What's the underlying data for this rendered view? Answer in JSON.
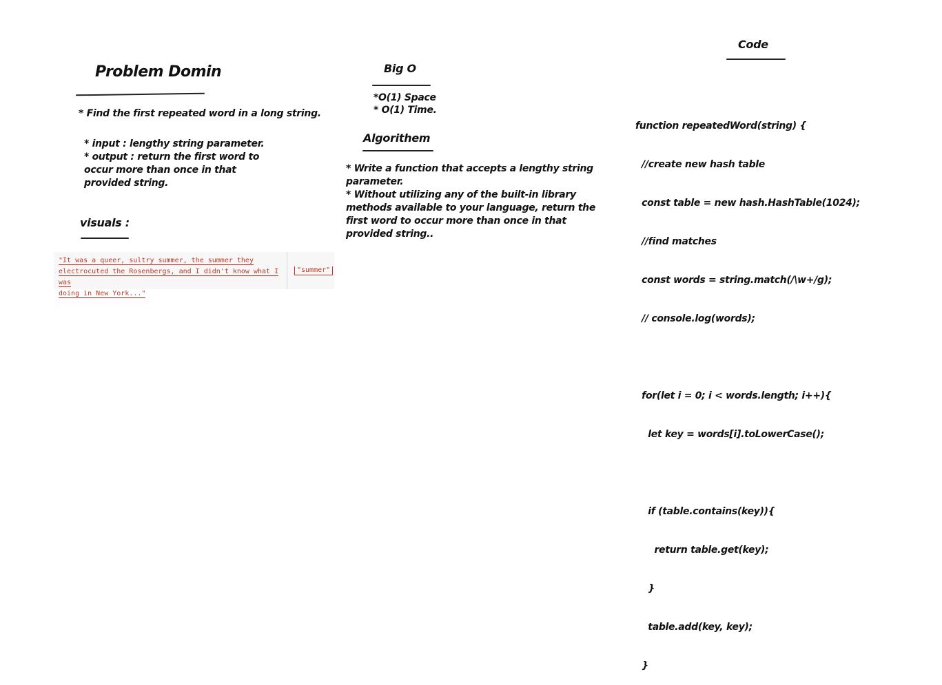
{
  "problem": {
    "heading": "Problem Domin",
    "statement": "* Find the first repeated word in a long string.",
    "input": "* input :  lengthy string parameter.",
    "output_lines": [
      "* output :  return the first word to",
      "occur more than once in that",
      "provided string."
    ]
  },
  "visuals": {
    "heading": "visuals :",
    "quote_lines": [
      "\"It was a queer, sultry summer, the summer they",
      "electrocuted the Rosenbergs, and I didn't know what I was",
      "doing in New York...\""
    ],
    "result": "\"summer\""
  },
  "bigo": {
    "heading": "Big O",
    "lines": [
      "*O(1) Space",
      "* O(1) Time."
    ]
  },
  "algorithm": {
    "heading": "Algorithem",
    "lines": [
      "* Write a function that accepts a lengthy string",
      "parameter.",
      "* Without utilizing any of the built-in library",
      "methods available to your language, return the",
      "first word to occur more than once in that",
      "provided string.."
    ]
  },
  "code": {
    "heading": "Code",
    "lines": [
      "function repeatedWord(string) {",
      "  //create new hash table",
      "  const table = new hash.HashTable(1024);",
      "  //find matches",
      "  const words = string.match(/\\w+/g);",
      "  // console.log(words);",
      "",
      "  for(let i = 0; i < words.length; i++){",
      "    let key = words[i].toLowerCase();",
      "",
      "    if (table.contains(key)){",
      "      return table.get(key);",
      "    }",
      "    table.add(key, key);",
      "  }"
    ]
  }
}
